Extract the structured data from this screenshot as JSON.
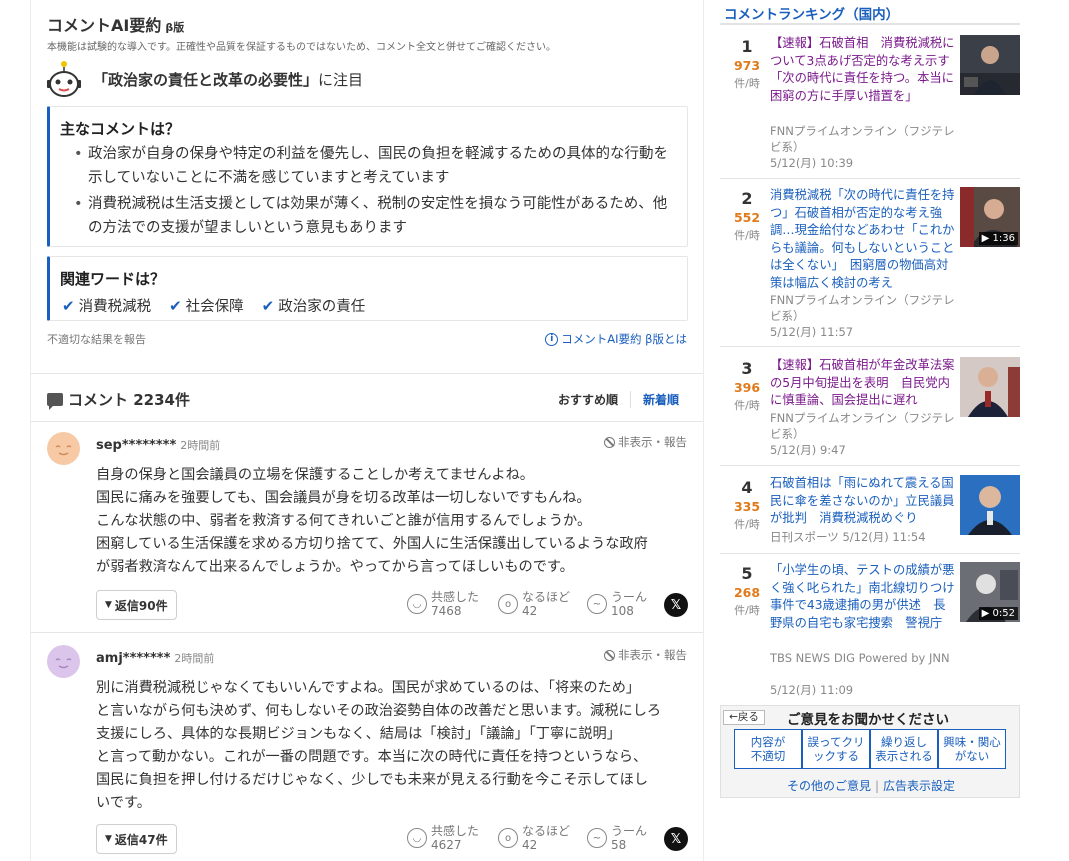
{
  "ai_summary": {
    "title": "コメントAI要約",
    "beta": "β版",
    "notice": "本機能は試験的な導入です。正確性や品質を保証するものではないため、コメント全文と併せてご確認ください。",
    "focus_topic": "「政治家の責任と改革の必要性」",
    "focus_suffix": "に注目",
    "main_heading": "主なコメントは？",
    "main_points": [
      "政治家が自身の保身や特定の利益を優先し、国民の負担を軽減するための具体的な行動を示していないことに不満を感じていますと考えています",
      "消費税減税は生活支援としては効果が薄く、税制の安定性を損なう可能性があるため、他の方法での支援が望ましいという意見もあります"
    ],
    "words_heading": "関連ワードは？",
    "words": [
      "消費税減税",
      "社会保障",
      "政治家の責任"
    ],
    "report_link": "不適切な結果を報告",
    "about_link": "コメントAI要約 β版とは",
    "about_icon": "info-icon"
  },
  "comments_header": {
    "title": "コメント 2234件",
    "sort_recommended": "おすすめ順",
    "sort_newest": "新着順"
  },
  "comments": [
    {
      "user": "sep********",
      "time": "2時間前",
      "hide_report": "非表示・報告",
      "lines": [
        "自身の保身と国会議員の立場を保護することしか考えてませんよね。",
        "国民に痛みを強要しても、国会議員が身を切る改革は一切しないですもんね。",
        "こんな状態の中、弱者を救済する何てきれいごと誰が信用するんでしょうか。",
        "困窮している生活保護を求める方切り捨てて、外国人に生活保護出しているような政府",
        "が弱者救済なんて出来るんでしょうか。やってから言ってほしいものです。"
      ],
      "replies": "返信90件",
      "empathy_label": "共感した",
      "empathy": "7468",
      "naruhodo_label": "なるほど",
      "naruhodo": "42",
      "uun_label": "うーん",
      "uun": "108"
    },
    {
      "user": "amj*******",
      "time": "2時間前",
      "hide_report": "非表示・報告",
      "lines": [
        "別に消費税減税じゃなくてもいいんですよね。国民が求めているのは、「将来のため」",
        "と言いながら何も決めず、何もしないその政治姿勢自体の改善だと思います。減税にしろ",
        "支援にしろ、具体的な長期ビジョンもなく、結局は「検討」「議論」「丁寧に説明」",
        "と言って動かない。これが一番の問題です。本当に次の時代に責任を持つというなら、",
        "国民に負担を押し付けるだけじゃなく、少しでも未来が見える行動を今こそ示してほし",
        "いです。"
      ],
      "replies": "返信47件",
      "empathy_label": "共感した",
      "empathy": "4627",
      "naruhodo_label": "なるほど",
      "naruhodo": "42",
      "uun_label": "うーん",
      "uun": "58"
    }
  ],
  "ranking": {
    "title": "コメントランキング（国内）",
    "unit": "件/時",
    "items": [
      {
        "rank": "1",
        "count": "973",
        "headline": "【速報】石破首相　消費税減税について3点あげ否定的な考え示す「次の時代に責任を持つ。本当に困窮の方に手厚い措置を」",
        "source": "FNNプライムオンライン（フジテレビ系）",
        "date": "5/12(月) 10:39",
        "visited": true
      },
      {
        "rank": "2",
        "count": "552",
        "headline": "消費税減税「次の時代に責任を持つ」石破首相が否定的な考え強調…現金給付などあわせ「これからも議論。何もしないということは全くない」　困窮層の物価高対策は幅広く検討の考え",
        "source": "FNNプライムオンライン（フジテレビ系）",
        "date": "5/12(月) 11:57",
        "video": "1:36",
        "visited": false
      },
      {
        "rank": "3",
        "count": "396",
        "headline": "【速報】石破首相が年金改革法案の5月中旬提出を表明　自民党内に慎重論、国会提出に遅れ",
        "source": "FNNプライムオンライン（フジテレビ系）",
        "date": "5/12(月) 9:47",
        "visited": true
      },
      {
        "rank": "4",
        "count": "335",
        "headline": "石破首相は「雨にぬれて震える国民に傘を差さないのか」立民議員が批判　消費税減税めぐり",
        "source": "日刊スポーツ",
        "date": "5/12(月) 11:54",
        "visited": false
      },
      {
        "rank": "5",
        "count": "268",
        "headline": "「小学生の頃、テストの成績が悪く強く叱られた」南北線切りつけ事件で43歳逮捕の男が供述　長野県の自宅も家宅捜索　警視庁",
        "source": "TBS NEWS DIG Powered by JNN",
        "date": "5/12(月) 11:09",
        "video": "0:52",
        "visited": false
      }
    ]
  },
  "feedback": {
    "back": "←戻る",
    "title": "ご意見をお聞かせください",
    "buttons": [
      "内容が\n不適切",
      "誤ってクリ\nックする",
      "繰り返し\n表示される",
      "興味・関心\nがない"
    ],
    "other": "その他のご意見",
    "ad_settings": "広告表示設定"
  },
  "colors": {
    "accent_blue": "#1a5fbd",
    "count_orange": "#e07a1a",
    "visited_purple": "#7b1a8c"
  }
}
